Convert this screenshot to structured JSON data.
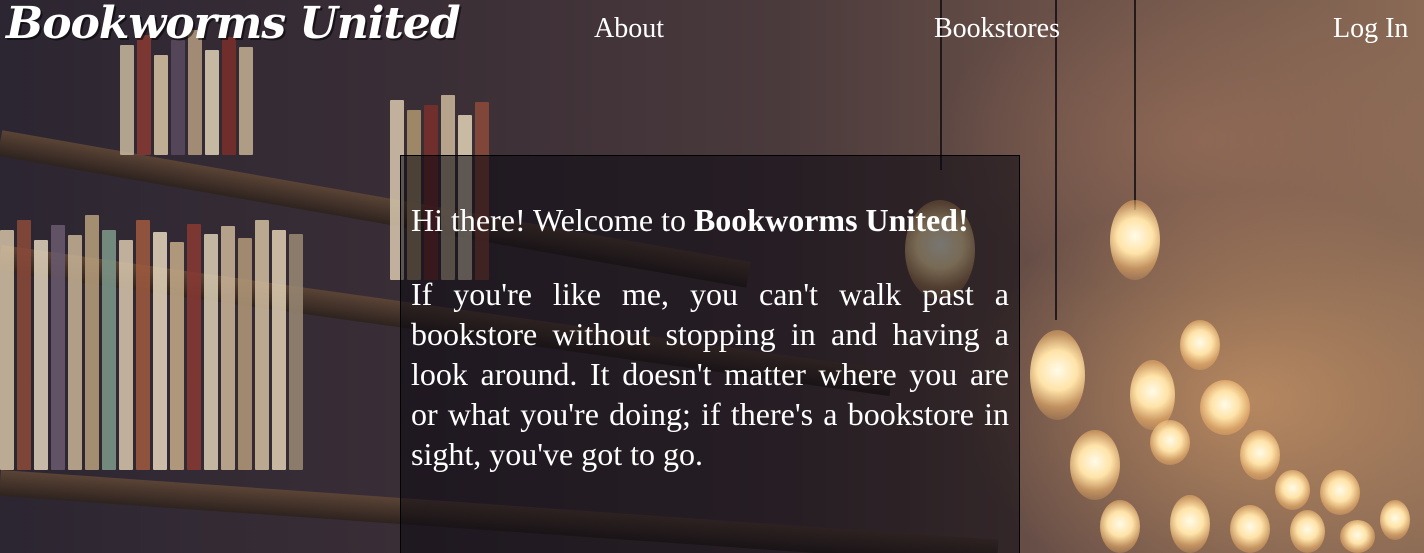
{
  "header": {
    "logo_text": "Bookworms United",
    "nav": [
      {
        "label": "About"
      },
      {
        "label": "Bookstores"
      },
      {
        "label": "Log In"
      }
    ]
  },
  "intro": {
    "greeting_prefix": "Hi there! Welcome to ",
    "greeting_brand": "Bookworms United!",
    "paragraph": "If you're like me, you can't walk past a bookstore without stopping in and having a look around. It doesn't matter where you are or what you're doing; if there's a bookstore in sight, you've got to go."
  },
  "colors": {
    "text": "#ffffff",
    "card_overlay": "#0a0810",
    "card_border": "#000000"
  }
}
